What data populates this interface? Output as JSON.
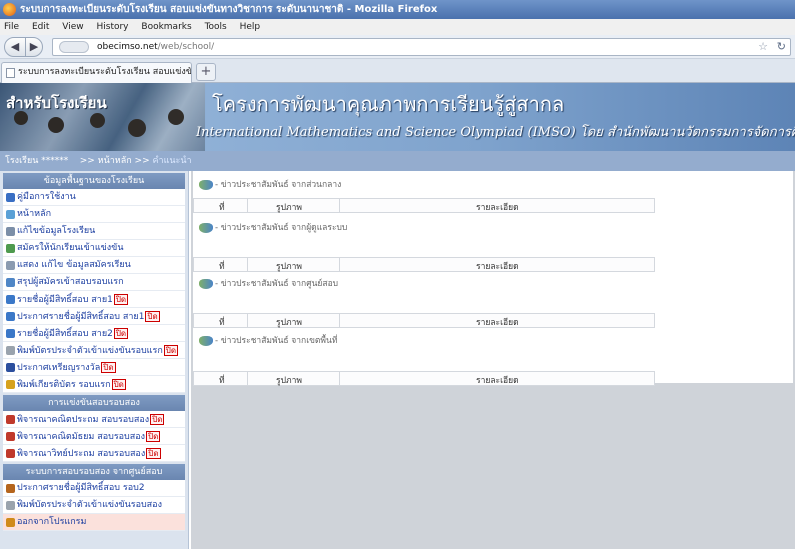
{
  "window": {
    "title": "ระบบการลงทะเบียนระดับโรงเรียน สอบแข่งขันทางวิชาการ ระดับนานาชาติ - Mozilla Firefox"
  },
  "menu": [
    "File",
    "Edit",
    "View",
    "History",
    "Bookmarks",
    "Tools",
    "Help"
  ],
  "address": {
    "host": "obecimso.net",
    "path": "/web/school/"
  },
  "tab": {
    "label": "ระบบการลงทะเบียนระดับโรงเรียน สอบแข่งขัน..."
  },
  "banner": {
    "school_label": "สำหรับโรงเรียน",
    "title_th": "โครงการพัฒนาคุณภาพการเรียนรู้สู่สากล",
    "title_en": "International Mathematics and Science Olympiad (IMSO) โดย สำนักพัฒนานวัตกรรมการจัดการศึกษา"
  },
  "breadcrumb": {
    "school": "โรงเรียน ******",
    "home": ">> หน้าหลัก >>",
    "current": "คำแนะนำ"
  },
  "sidebar": {
    "sections": [
      {
        "title": "ข้อมูลพื้นฐานของโรงเรียน",
        "items": [
          {
            "label": "คู่มือการใช้งาน",
            "closed": false,
            "icon": "book-icon"
          },
          {
            "label": "หน้าหลัก",
            "closed": false,
            "icon": "home-icon"
          },
          {
            "label": "แก้ไขข้อมูลโรงเรียน",
            "closed": false,
            "icon": "edit-icon"
          },
          {
            "label": "สมัครให้นักเรียนเข้าแข่งขัน",
            "closed": false,
            "icon": "apply-icon"
          },
          {
            "label": "แสดง แก้ไข ข้อมูลสมัครเรียน",
            "closed": false,
            "icon": "list-icon"
          },
          {
            "label": "สรุปผู้สมัครเข้าสอบรอบแรก",
            "closed": false,
            "icon": "summary-icon"
          },
          {
            "label": "รายชื่อผู้มีสิทธิ์สอบ สาย1",
            "closed": true,
            "icon": "globe-icon"
          },
          {
            "label": "ประกาศรายชื่อผู้มีสิทธิ์สอบ สาย1",
            "closed": true,
            "icon": "globe-icon"
          },
          {
            "label": "รายชื่อผู้มีสิทธิ์สอบ สาย2",
            "closed": true,
            "icon": "globe-icon"
          },
          {
            "label": "พิมพ์บัตรประจำตัวเข้าแข่งขันรอบแรก",
            "closed": true,
            "icon": "print-icon"
          },
          {
            "label": "ประกาศเหรียญรางวัล",
            "closed": true,
            "icon": "medal-icon"
          },
          {
            "label": "พิมพ์เกียรติบัตร รอบแรก",
            "closed": true,
            "icon": "certificate-icon"
          }
        ]
      },
      {
        "title": "การแข่งขันสอบรอบสอง",
        "items": [
          {
            "label": "พิจารณาคณิตประถม สอบรอบสอง",
            "closed": true,
            "icon": "check-icon"
          },
          {
            "label": "พิจารณาคณิตมัธยม สอบรอบสอง",
            "closed": true,
            "icon": "check-icon"
          },
          {
            "label": "พิจารณาวิทย์ประถม สอบรอบสอง",
            "closed": true,
            "icon": "check-icon"
          }
        ]
      },
      {
        "title": "ระบบการสอบรอบสอง จากศูนย์สอบ",
        "items": [
          {
            "label": "ประกาศรายชื่อผู้มีสิทธิ์สอบ รอบ2",
            "closed": false,
            "icon": "announce-icon"
          },
          {
            "label": "พิมพ์บัตรประจำตัวเข้าแข่งขันรอบสอง",
            "closed": false,
            "icon": "print-icon"
          },
          {
            "label": "ออกจากโปรแกรม",
            "closed": false,
            "icon": "exit-icon",
            "exit": true
          }
        ]
      }
    ],
    "closed_tag": "ปิด"
  },
  "news": [
    {
      "heading": "- ข่าวประชาสัมพันธ์ จากส่วนกลาง",
      "cols": [
        "ที่",
        "รูปภาพ",
        "รายละเอียด"
      ]
    },
    {
      "heading": "- ข่าวประชาสัมพันธ์ จากผู้ดูแลระบบ",
      "cols": [
        "ที่",
        "รูปภาพ",
        "รายละเอียด"
      ]
    },
    {
      "heading": "- ข่าวประชาสัมพันธ์ จากศูนย์สอบ",
      "cols": [
        "ที่",
        "รูปภาพ",
        "รายละเอียด"
      ]
    },
    {
      "heading": "- ข่าวประชาสัมพันธ์ จากเขตพื้นที่",
      "cols": [
        "ที่",
        "รูปภาพ",
        "รายละเอียด"
      ]
    }
  ],
  "colors": {
    "titlebar": "#4a71ad",
    "banner": "#8fb0d6",
    "crumbbar": "#94acce",
    "section_header": "#7f9bc3",
    "closed_tag": "#cc0000",
    "link": "#1a3da0"
  }
}
